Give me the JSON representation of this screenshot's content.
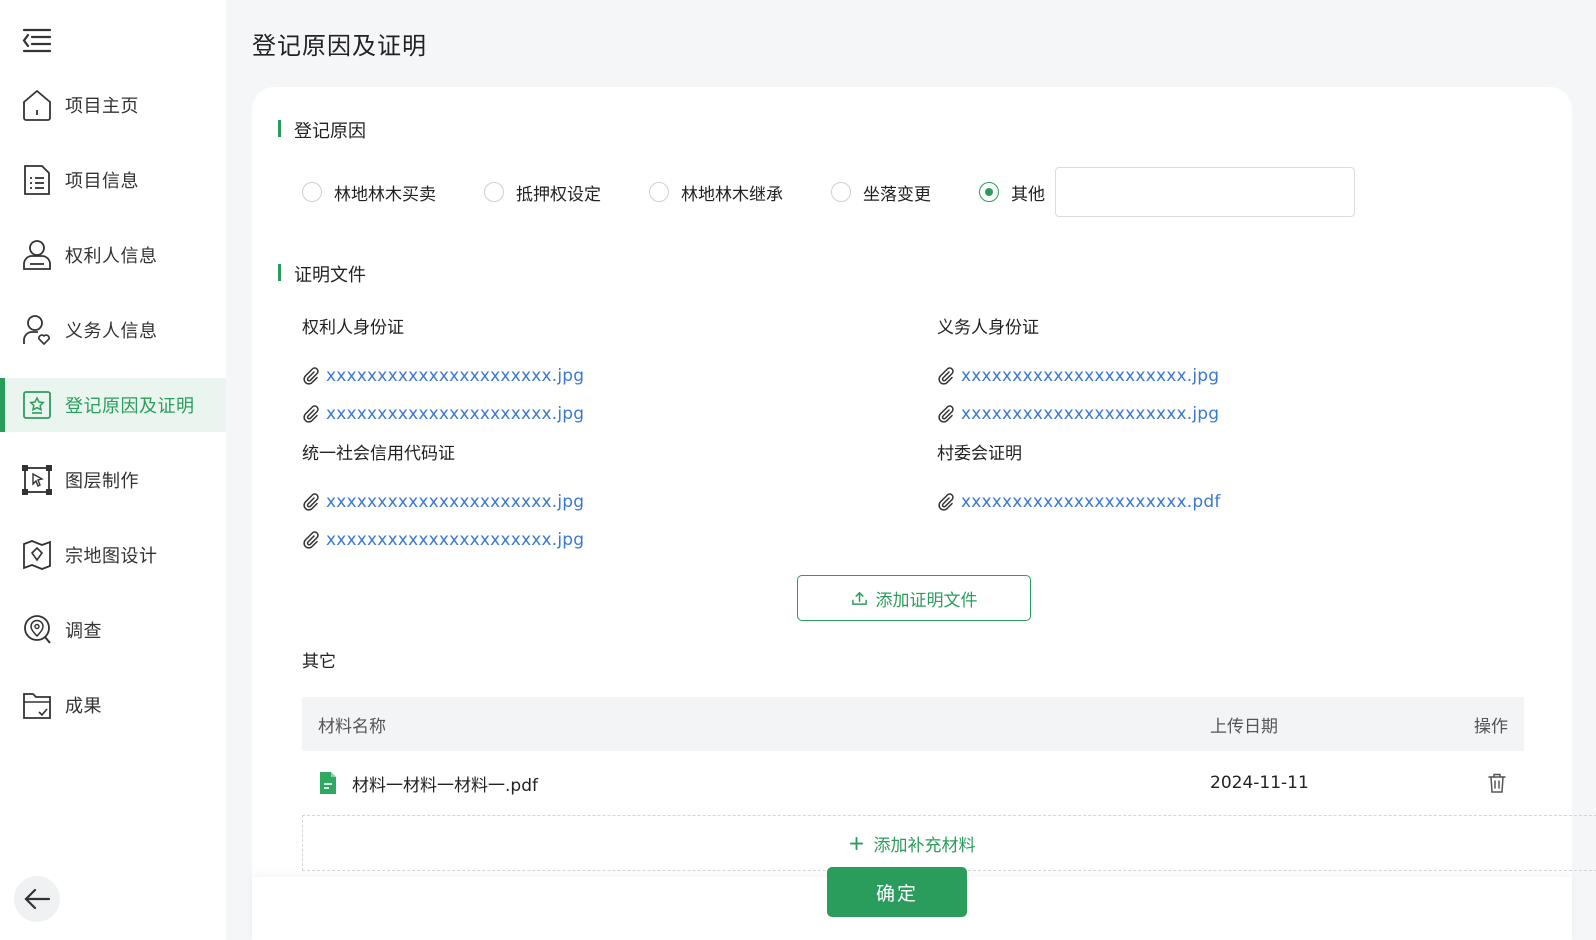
{
  "page_title": "登记原因及证明",
  "sidebar": {
    "items": [
      {
        "label": "项目主页",
        "icon": "home-icon"
      },
      {
        "label": "项目信息",
        "icon": "list-icon"
      },
      {
        "label": "权利人信息",
        "icon": "user-card-icon"
      },
      {
        "label": "义务人信息",
        "icon": "user-heart-icon"
      },
      {
        "label": "登记原因及证明",
        "icon": "star-badge-icon",
        "active": true
      },
      {
        "label": "图层制作",
        "icon": "layer-select-icon"
      },
      {
        "label": "宗地图设计",
        "icon": "map-icon"
      },
      {
        "label": "调查",
        "icon": "location-search-icon"
      },
      {
        "label": "成果",
        "icon": "folder-check-icon"
      }
    ]
  },
  "reason_section": {
    "title": "登记原因",
    "options": [
      "林地林木买卖",
      "抵押权设定",
      "林地林木继承",
      "坐落变更",
      "其他"
    ],
    "selected": "其他",
    "other_value": ""
  },
  "proof_section": {
    "title": "证明文件",
    "groups": [
      {
        "label": "权利人身份证",
        "files": [
          "xxxxxxxxxxxxxxxxxxxxxx.jpg",
          "xxxxxxxxxxxxxxxxxxxxxx.jpg"
        ]
      },
      {
        "label": "义务人身份证",
        "files": [
          "xxxxxxxxxxxxxxxxxxxxxx.jpg",
          "xxxxxxxxxxxxxxxxxxxxxx.jpg"
        ]
      },
      {
        "label": "统一社会信用代码证",
        "files": [
          "xxxxxxxxxxxxxxxxxxxxxx.jpg",
          "xxxxxxxxxxxxxxxxxxxxxx.jpg"
        ]
      },
      {
        "label": "村委会证明",
        "files": [
          "xxxxxxxxxxxxxxxxxxxxxx.pdf"
        ]
      }
    ],
    "add_button": "添加证明文件"
  },
  "other_section": {
    "label": "其它",
    "table": {
      "headers": [
        "材料名称",
        "上传日期",
        "操作"
      ],
      "rows": [
        {
          "name": "材料一材料一材料一.pdf",
          "date": "2024-11-11"
        }
      ]
    },
    "add_more": "添加补充材料"
  },
  "confirm_label": "确定",
  "colors": {
    "accent": "#2a9d5c",
    "link": "#3a79d3"
  }
}
